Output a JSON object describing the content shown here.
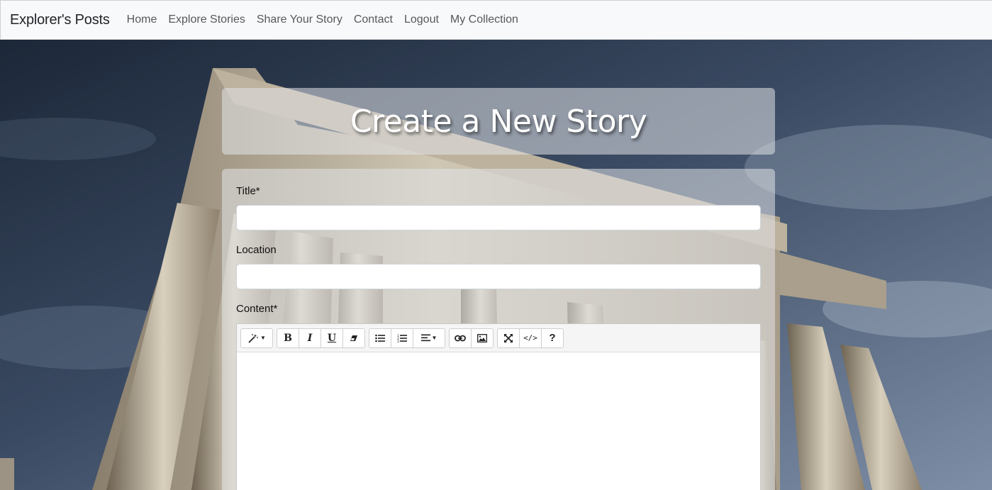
{
  "navbar": {
    "brand": "Explorer's Posts",
    "links": [
      "Home",
      "Explore Stories",
      "Share Your Story",
      "Contact",
      "Logout",
      "My Collection"
    ]
  },
  "header": {
    "title": "Create a New Story"
  },
  "form": {
    "title_label": "Title*",
    "title_value": "",
    "location_label": "Location",
    "location_value": "",
    "content_label": "Content*",
    "content_value": ""
  },
  "editor_toolbar": {
    "groups": [
      [
        "magic-icon"
      ],
      [
        "bold-icon",
        "italic-icon",
        "underline-icon",
        "eraser-icon"
      ],
      [
        "unordered-list-icon",
        "ordered-list-icon",
        "align-icon"
      ],
      [
        "link-icon",
        "picture-icon"
      ],
      [
        "fullscreen-icon",
        "code-view-icon",
        "help-icon"
      ]
    ]
  }
}
